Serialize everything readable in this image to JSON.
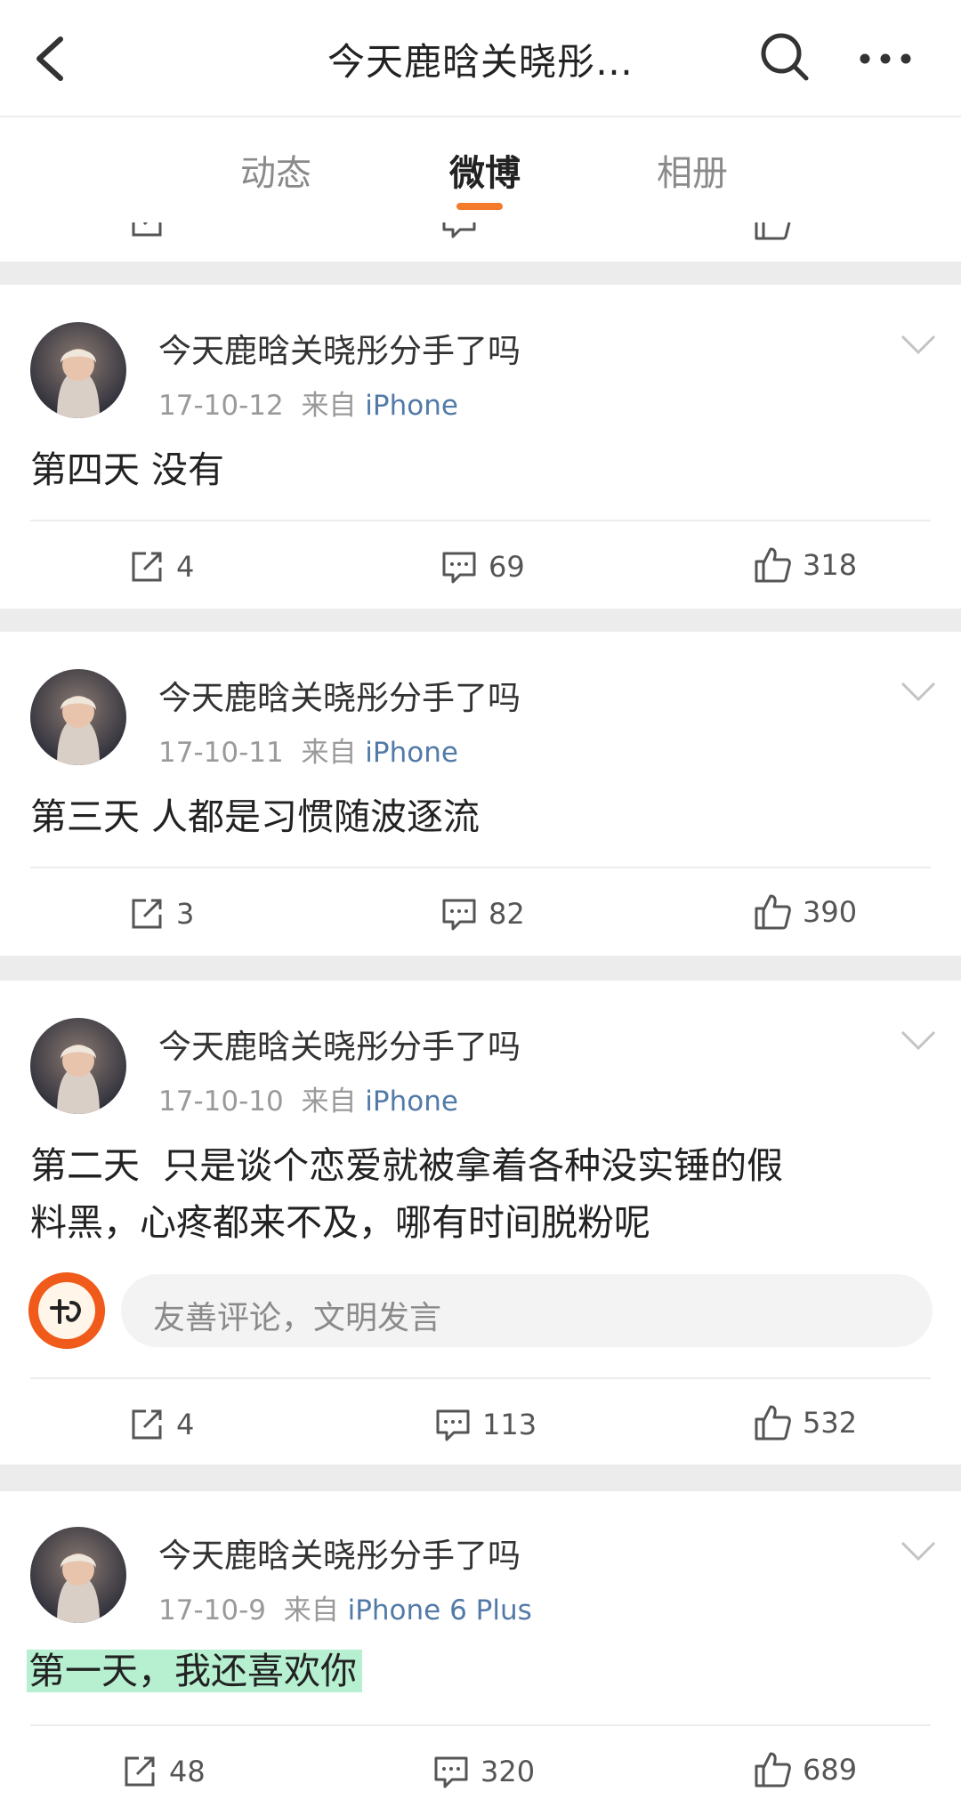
{
  "header": {
    "title": "今天鹿晗关晓彤…"
  },
  "tabs": [
    {
      "label": "动态"
    },
    {
      "label": "微博"
    },
    {
      "label": "相册"
    }
  ],
  "accent_color": "#f47b2a",
  "icons": [
    "back-icon",
    "search-icon",
    "more-icon",
    "repost-icon",
    "comment-icon",
    "like-icon",
    "chevron-down-icon"
  ],
  "posts": [
    {
      "username": "今天鹿晗关晓彤分手了吗",
      "date": "17-10-12",
      "from": "来自",
      "source": "iPhone",
      "content": "第四天 没有",
      "reposts": "4",
      "comments": "69",
      "likes": "318"
    },
    {
      "username": "今天鹿晗关晓彤分手了吗",
      "date": "17-10-11",
      "from": "来自",
      "source": "iPhone",
      "content": "第三天 人都是习惯随波逐流",
      "reposts": "3",
      "comments": "82",
      "likes": "390"
    },
    {
      "username": "今天鹿晗关晓彤分手了吗",
      "date": "17-10-10",
      "from": "来自",
      "source": "iPhone",
      "content_line1": "第二天  只是谈个恋爱就被拿着各种没实锤的假",
      "content_line2": "料黑，心疼都来不及，哪有时间脱粉呢",
      "comment_placeholder": "友善评论，文明发言",
      "reposts": "4",
      "comments": "113",
      "likes": "532"
    },
    {
      "username": "今天鹿晗关晓彤分手了吗",
      "date": "17-10-9",
      "from": "来自",
      "source": "iPhone 6 Plus",
      "content": "第一天，我还喜欢你",
      "reposts": "48",
      "comments": "320",
      "likes": "689"
    }
  ]
}
